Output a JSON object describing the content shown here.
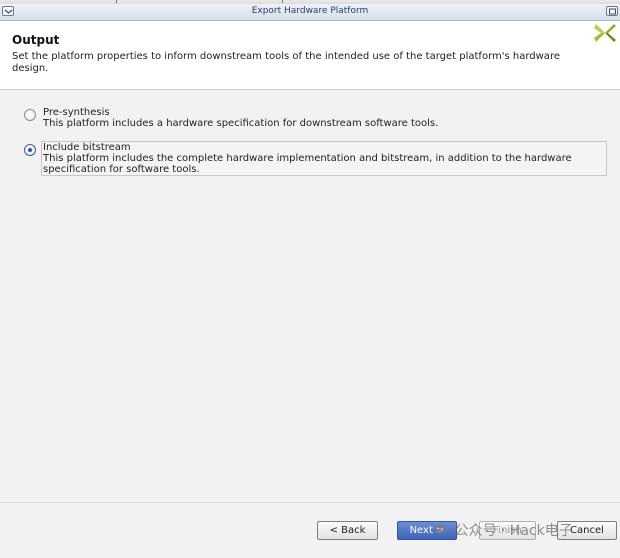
{
  "window": {
    "title": "Export Hardware Platform"
  },
  "header": {
    "title": "Output",
    "description": "Set the platform properties to inform downstream tools of the intended use of the target platform's hardware design.",
    "logo_icon": "xilinx-logo-icon"
  },
  "options": [
    {
      "label": "Pre-synthesis",
      "description": "This platform includes a hardware specification for downstream software tools.",
      "selected": false
    },
    {
      "label": "Include bitstream",
      "description": "This platform includes the complete hardware implementation and bitstream, in addition to the hardware specification for software tools.",
      "selected": true
    }
  ],
  "buttons": {
    "back": "< Back",
    "next": "Next >",
    "finish": "Finish",
    "cancel": "Cancel"
  },
  "watermark": {
    "text": "公众号 · Hack电子"
  },
  "colors": {
    "accent": "#4a6fc0",
    "logo_green": "#8db020"
  }
}
